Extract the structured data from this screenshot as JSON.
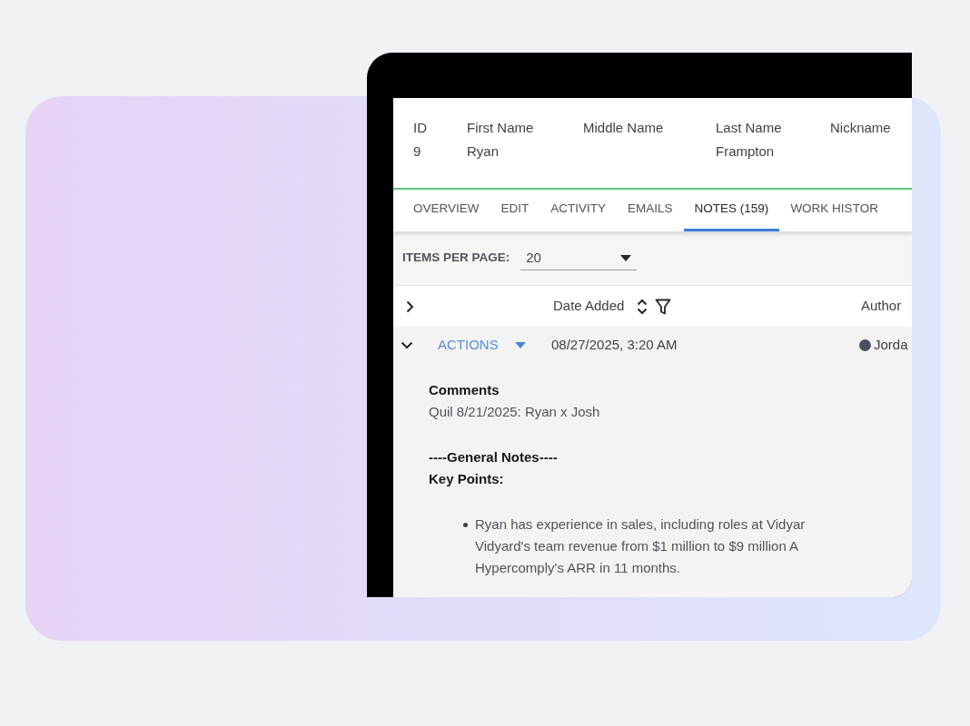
{
  "record": {
    "fields": [
      {
        "label": "ID",
        "value": "9"
      },
      {
        "label": "First Name",
        "value": "Ryan"
      },
      {
        "label": "Middle Name"
      },
      {
        "label": "Last Name",
        "value": "Frampton"
      },
      {
        "label": "Nickname"
      }
    ]
  },
  "tabs": [
    {
      "label": "OVERVIEW",
      "selected": false
    },
    {
      "label": "EDIT",
      "selected": false
    },
    {
      "label": "ACTIVITY",
      "selected": false
    },
    {
      "label": "EMAILS",
      "selected": false
    },
    {
      "label": "NOTES (159)",
      "selected": true
    },
    {
      "label": "WORK HISTOR",
      "selected": false
    }
  ],
  "pagination": {
    "label": "ITEMS PER PAGE:",
    "value": "20"
  },
  "table": {
    "columns": [
      {
        "label": "Date Added",
        "sortable": true,
        "filterable": true
      },
      {
        "label": "Author",
        "sortable": false,
        "filterable": false
      }
    ],
    "rows": [
      {
        "expanded": true,
        "actions": "ACTIONS",
        "date_added": "08/27/2025, 3:20 AM",
        "author": "Jorda",
        "note": [
          {
            "kind": "heading",
            "text": "Comments"
          },
          {
            "kind": "text",
            "text": "Quil 8/21/2025: Ryan x Josh"
          },
          {
            "kind": "heading",
            "text": "----General Notes----"
          },
          {
            "kind": "heading",
            "text": "Key Points:"
          },
          {
            "kind": "bullet",
            "lines": [
              "Ryan has experience in sales, including roles at Vidyar",
              "Vidyard's team revenue from $1 million to $9 million A",
              "Hypercomply's ARR in 11 months."
            ]
          }
        ]
      }
    ]
  }
}
